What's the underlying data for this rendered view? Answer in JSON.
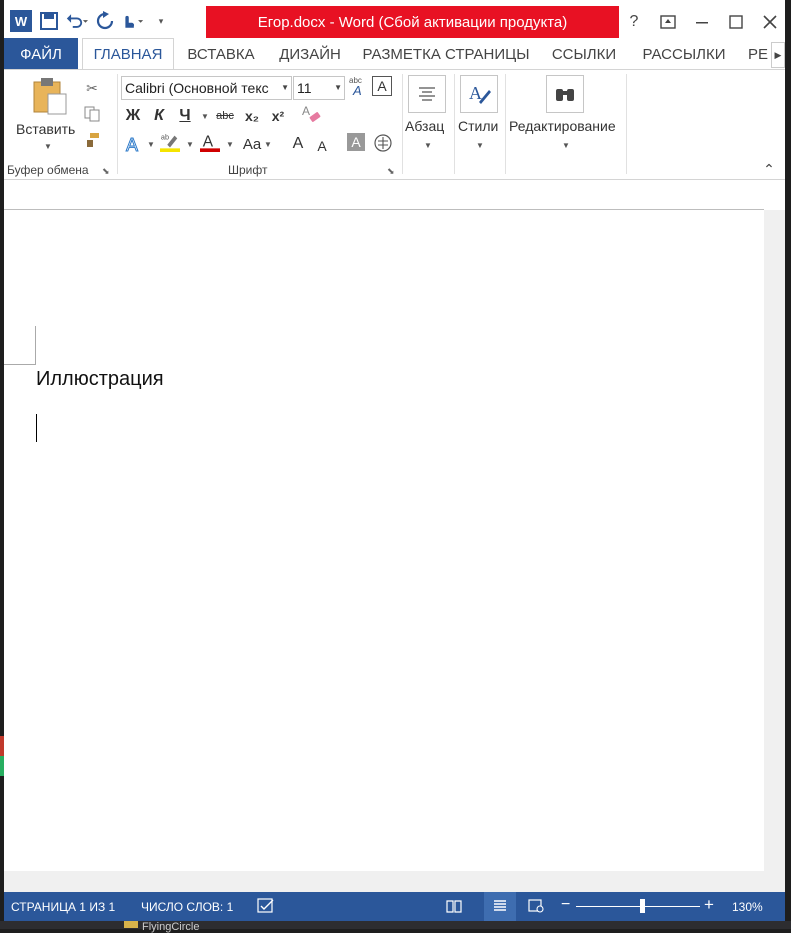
{
  "window": {
    "title": "Егор.docx -  Word (Сбой активации продукта)",
    "title_bar_color": "#e81123",
    "accent": "#2b579a"
  },
  "quick_access": {
    "app_icon": "word-logo-icon",
    "app_letter": "W",
    "save_icon": "save-icon",
    "undo_icon": "undo-icon",
    "redo_icon": "redo-icon",
    "touch_icon": "touch-mode-icon"
  },
  "window_controls": {
    "help": "?",
    "ribbon_options": "ribbon-display-icon",
    "minimize": "minimize-icon",
    "maximize": "maximize-icon",
    "close": "close-icon"
  },
  "tabs": {
    "file": "ФАЙЛ",
    "home": "ГЛАВНАЯ",
    "insert": "ВСТАВКА",
    "design": "ДИЗАЙН",
    "layout": "РАЗМЕТКА СТРАНИЦЫ",
    "references": "ССЫЛКИ",
    "mailings": "РАССЫЛКИ",
    "review": "РЕ"
  },
  "clipboard": {
    "paste_label": "Вставить",
    "group_label": "Буфер обмена"
  },
  "font": {
    "font_name": "Calibri (Основной текс",
    "font_size": "11",
    "bold": "Ж",
    "italic": "К",
    "underline": "Ч",
    "strike": "abc",
    "subscript": "x₂",
    "superscript": "x²",
    "change_case": "Aa",
    "grow": "A",
    "shrink": "A",
    "group_label": "Шрифт"
  },
  "paragraph": {
    "label": "Абзац"
  },
  "styles": {
    "label": "Стили"
  },
  "editing": {
    "label": "Редактирование"
  },
  "document": {
    "text": "Иллюстрация"
  },
  "status": {
    "page": "СТРАНИЦА 1 ИЗ 1",
    "words": "ЧИСЛО СЛОВ: 1",
    "zoom_minus": "−",
    "zoom_plus": "+",
    "zoom": "130%",
    "zoom_level": 0.52
  },
  "taskbar": {
    "folder": "FlyingCircle"
  }
}
